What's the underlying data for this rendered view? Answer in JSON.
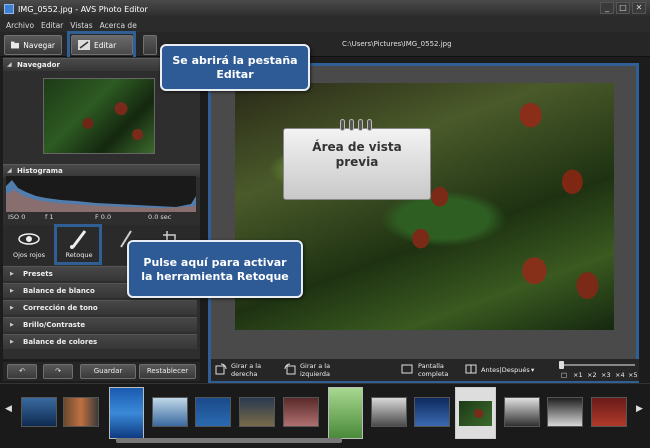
{
  "window": {
    "title": "IMG_0552.jpg  -  AVS Photo Editor",
    "controls": [
      "_",
      "□",
      "✕"
    ]
  },
  "menu": [
    "Archivo",
    "Editar",
    "Vistas",
    "Acerca de"
  ],
  "toolbar": {
    "navegar": "Navegar",
    "editar": "Editar",
    "filepath": "C:\\Users\\Pictures\\IMG_0552.jpg"
  },
  "left": {
    "navegador": "Navegador",
    "histograma": "Histograma",
    "histo_labels": [
      "ISO 0",
      "f 1",
      "F 0.0",
      "0.0 sec"
    ],
    "tools": [
      {
        "label": "Ojos rojos",
        "icon": "eye-icon"
      },
      {
        "label": "Retoque",
        "icon": "brush-icon"
      }
    ],
    "categories": [
      "Presets",
      "Balance de blanco",
      "Corrección de tono",
      "Brillo/Contraste",
      "Balance de colores"
    ],
    "buttons": {
      "guardar": "Guardar",
      "restablecer": "Restablecer"
    }
  },
  "preview_toolbar": {
    "rotate_right": "Girar a la\nderecha",
    "rotate_left": "Girar a la\nizquierda",
    "fullscreen": "Pantalla\ncompleta",
    "before_after": "Antes|Después",
    "zoom_labels": [
      "1",
      "2",
      "3",
      "4",
      "5"
    ]
  },
  "callouts": {
    "editar": "Se abrirá la pestaña\nEditar",
    "preview": "Área de vista\nprevia",
    "retoque": "Pulse aquí para activar\nla herramienta Retoque"
  },
  "colors": {
    "accent": "#2f5f95",
    "callout_bg": "#2e5b96"
  }
}
